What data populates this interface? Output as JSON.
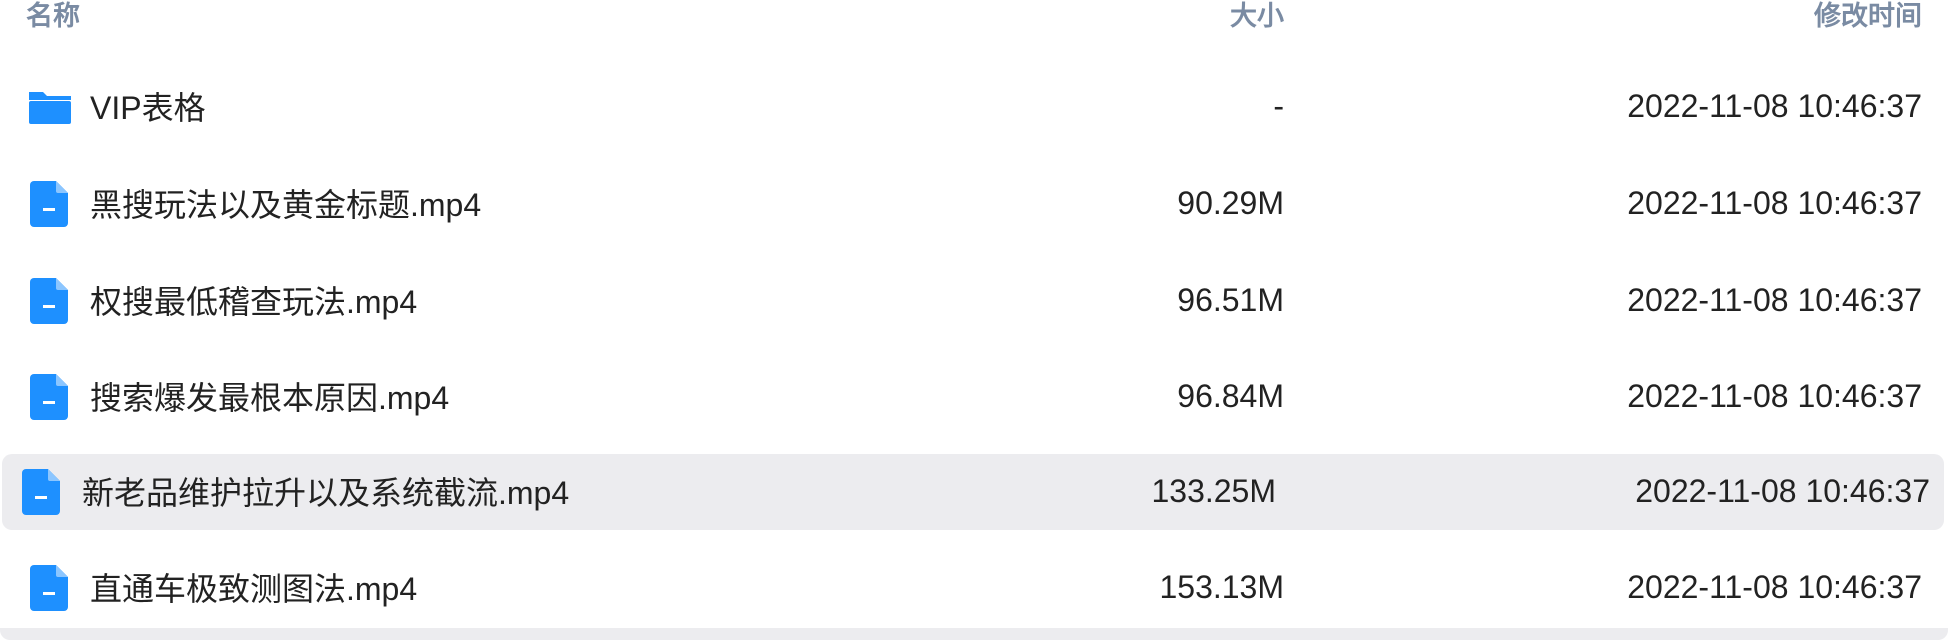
{
  "columns": {
    "name": "名称",
    "size": "大小",
    "modified": "修改时间"
  },
  "accent_color": "#1e90ff",
  "files": [
    {
      "icon": "folder-icon",
      "name": "VIP表格",
      "size": "-",
      "modified": "2022-11-08 10:46:37"
    },
    {
      "icon": "file-icon",
      "name": "黑搜玩法以及黄金标题.mp4",
      "size": "90.29M",
      "modified": "2022-11-08 10:46:37"
    },
    {
      "icon": "file-icon",
      "name": "权搜最低稽查玩法.mp4",
      "size": "96.51M",
      "modified": "2022-11-08 10:46:37"
    },
    {
      "icon": "file-icon",
      "name": "搜索爆发最根本原因.mp4",
      "size": "96.84M",
      "modified": "2022-11-08 10:46:37"
    },
    {
      "icon": "file-icon",
      "name": "新老品维护拉升以及系统截流.mp4",
      "size": "133.25M",
      "modified": "2022-11-08 10:46:37",
      "selected": true
    },
    {
      "icon": "file-icon",
      "name": "直通车极致测图法.mp4",
      "size": "153.13M",
      "modified": "2022-11-08 10:46:37"
    }
  ]
}
